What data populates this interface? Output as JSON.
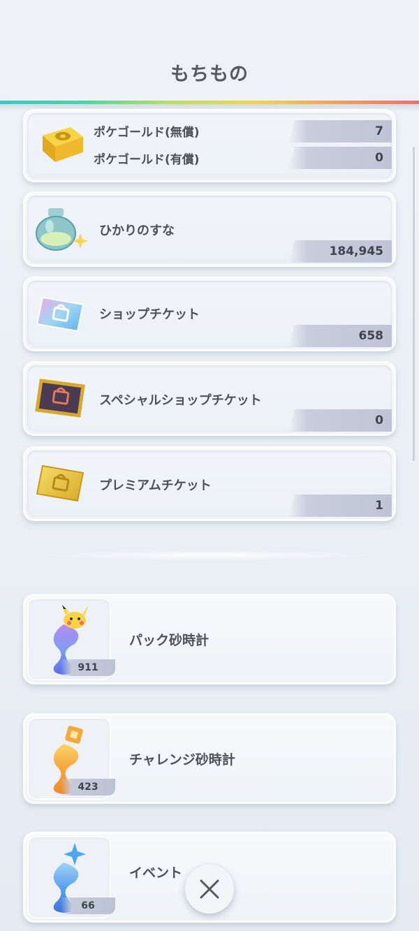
{
  "header": {
    "title": "もちもの"
  },
  "currencies": [
    {
      "name": "ポケゴールド(無償)",
      "value": "7"
    },
    {
      "name": "ポケゴールド(有償)",
      "value": "0"
    }
  ],
  "items": [
    {
      "name": "ひかりのすな",
      "value": "184,945",
      "icon": "stardust-bottle-icon"
    },
    {
      "name": "ショップチケット",
      "value": "658",
      "icon": "shop-ticket-icon"
    },
    {
      "name": "スペシャルショップチケット",
      "value": "0",
      "icon": "special-shop-ticket-icon"
    },
    {
      "name": "プレミアムチケット",
      "value": "1",
      "icon": "premium-ticket-icon"
    }
  ],
  "hourglasses": [
    {
      "name": "パック砂時計",
      "count": "911",
      "icon": "pack-hourglass-icon"
    },
    {
      "name": "チャレンジ砂時計",
      "count": "423",
      "icon": "challenge-hourglass-icon"
    },
    {
      "name": "イベント",
      "count": "66",
      "icon": "event-hourglass-icon"
    }
  ],
  "colors": {
    "accent_rainbow": [
      "#38c9c9",
      "#b6e060",
      "#f2d64a",
      "#ee6f6f"
    ],
    "value_bar": "#c3c8d9"
  }
}
